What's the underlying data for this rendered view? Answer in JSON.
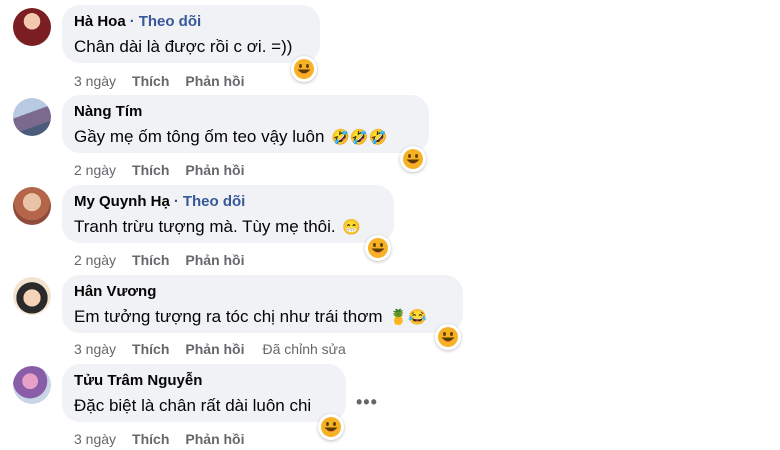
{
  "comments": [
    {
      "name": "Hà Hoa",
      "follow": "Theo dõi",
      "text": "Chân dài là được rồi c ơi. =))",
      "emoji": "",
      "time": "3 ngày",
      "like": "Thích",
      "reply": "Phản hồi",
      "edited": "",
      "reaction_icon": "laugh-reaction-icon"
    },
    {
      "name": "Nàng Tím",
      "follow": "",
      "text": "Gầy mẹ ốm tông ốm teo vậy luôn",
      "emoji": "🤣🤣🤣",
      "time": "2 ngày",
      "like": "Thích",
      "reply": "Phản hồi",
      "edited": "",
      "reaction_icon": "laugh-reaction-icon"
    },
    {
      "name": "My Quynh Hạ",
      "follow": "Theo dõi",
      "text": "Tranh trừu tượng mà. Tùy mẹ thôi.",
      "emoji": "😁",
      "time": "2 ngày",
      "like": "Thích",
      "reply": "Phản hồi",
      "edited": "",
      "reaction_icon": "laugh-reaction-icon"
    },
    {
      "name": "Hân Vương",
      "follow": "",
      "text": "Em tưởng tượng ra tóc chị như trái thơm",
      "emoji": "🍍😂",
      "time": "3 ngày",
      "like": "Thích",
      "reply": "Phản hồi",
      "edited": "Đã chỉnh sửa",
      "reaction_icon": "laugh-reaction-icon"
    },
    {
      "name": "Tửu Trâm Nguyễn",
      "follow": "",
      "text": "Đặc biệt là chân rất dài luôn chi",
      "emoji": "",
      "time": "3 ngày",
      "like": "Thích",
      "reply": "Phản hồi",
      "edited": "",
      "reaction_icon": "laugh-reaction-icon"
    }
  ],
  "more_options": "•••",
  "colors": {
    "bubble": "#f0f2f5",
    "link": "#385898",
    "meta": "#65676b",
    "reaction_face": "#f7b125"
  }
}
